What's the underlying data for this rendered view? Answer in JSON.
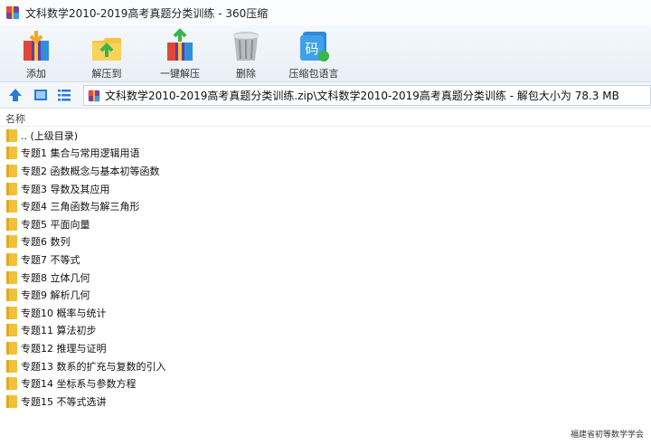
{
  "window": {
    "title": "文科数学2010-2019高考真题分类训练 - 360压缩"
  },
  "toolbar": {
    "buttons": [
      {
        "label": "添加",
        "icon": "archive-add-icon"
      },
      {
        "label": "解压到",
        "icon": "extract-to-icon"
      },
      {
        "label": "一键解压",
        "icon": "one-click-extract-icon"
      },
      {
        "label": "删除",
        "icon": "trash-bin-icon"
      },
      {
        "label": "压缩包语言",
        "icon": "archive-language-icon"
      }
    ]
  },
  "address": {
    "path": "文科数学2010-2019高考真题分类训练.zip\\文科数学2010-2019高考真题分类训练 - 解包大小为 78.3 MB"
  },
  "list": {
    "column_name": "名称",
    "items": [
      ".. (上级目录)",
      "专题1  集合与常用逻辑用语",
      "专题2  函数概念与基本初等函数",
      "专题3 导数及其应用",
      "专题4  三角函数与解三角形",
      "专题5  平面向量",
      "专题6 数列",
      "专题7 不等式",
      "专题8  立体几何",
      "专题9  解析几何",
      "专题10  概率与统计",
      "专题11 算法初步",
      "专题12  推理与证明",
      "专题13  数系的扩充与复数的引入",
      "专题14  坐标系与参数方程",
      "专题15 不等式选讲"
    ]
  },
  "watermark": "福建省初等数学学会",
  "colors": {
    "folder": "#f2c13c",
    "accent": "#2a7bd6",
    "toolbar_bg": "#eef3f9"
  }
}
